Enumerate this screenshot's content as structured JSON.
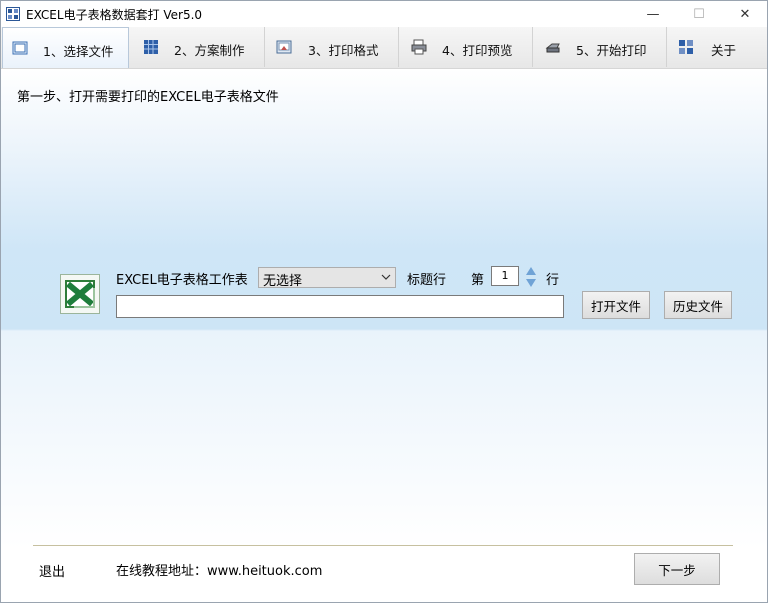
{
  "window": {
    "title": "EXCEL电子表格数据套打 Ver5.0",
    "controls": {
      "minimize": "—",
      "maximize": "☐",
      "close": "✕"
    }
  },
  "tabs": [
    {
      "label": "1、选择文件",
      "icon": "open-file-icon",
      "active": true
    },
    {
      "label": "2、方案制作",
      "icon": "grid-icon",
      "active": false
    },
    {
      "label": "3、打印格式",
      "icon": "format-icon",
      "active": false
    },
    {
      "label": "4、打印预览",
      "icon": "print-preview-icon",
      "active": false
    },
    {
      "label": "5、开始打印",
      "icon": "printer-icon",
      "active": false
    },
    {
      "label": "关于",
      "icon": "about-icon",
      "active": false
    }
  ],
  "main": {
    "step_title": "第一步、打开需要打印的EXCEL电子表格文件",
    "worksheet_label": "EXCEL电子表格工作表",
    "worksheet_select": {
      "value": "无选择"
    },
    "header_row_label": "标题行",
    "row_prefix": "第",
    "row_value": "1",
    "row_suffix": "行",
    "file_path": "",
    "open_button": "打开文件",
    "history_button": "历史文件"
  },
  "footer": {
    "exit": "退出",
    "tutorial": "在线教程地址：www.heituok.com",
    "next_button": "下一步"
  },
  "colors": {
    "accent_blue": "#cfe6f7",
    "excel_green": "#1e7d3c"
  }
}
